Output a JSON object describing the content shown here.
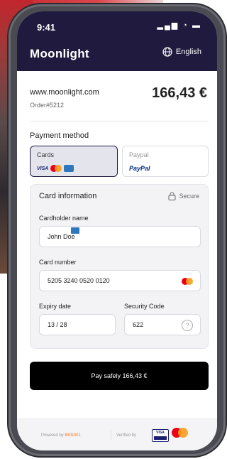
{
  "status": {
    "time": "9:41",
    "icons": "signal wifi battery"
  },
  "header": {
    "brand": "Moonlight",
    "language": "English"
  },
  "merchant": {
    "site": "www.moonlight.com",
    "order": "Order#5212",
    "amount": "166,43 €"
  },
  "payment_method": {
    "label": "Payment method",
    "options": [
      {
        "name": "Cards",
        "selected": true,
        "logos": [
          "VISA",
          "mastercard",
          "amex"
        ]
      },
      {
        "name": "Paypal",
        "selected": false,
        "logo": "PayPal"
      }
    ]
  },
  "card_info": {
    "title": "Card information",
    "secure": "Secure",
    "cardholder": {
      "label": "Cardholder name",
      "value": "John Doe"
    },
    "number": {
      "label": "Card number",
      "value": "5205 3240 0520 0120"
    },
    "expiry": {
      "label": "Expiry date",
      "value": "13 / 28"
    },
    "cvc": {
      "label": "Security Code",
      "value": "622"
    }
  },
  "pay_button": {
    "label": "Pay safely 166,43 €"
  },
  "footer": {
    "powered_prefix": "Powered by",
    "powered_brand": "BKN301",
    "verified": "Verified by",
    "visa": "VISA"
  },
  "colors": {
    "header": "#201a3e",
    "button": "#000000",
    "accent_orange": "#f07b23"
  }
}
